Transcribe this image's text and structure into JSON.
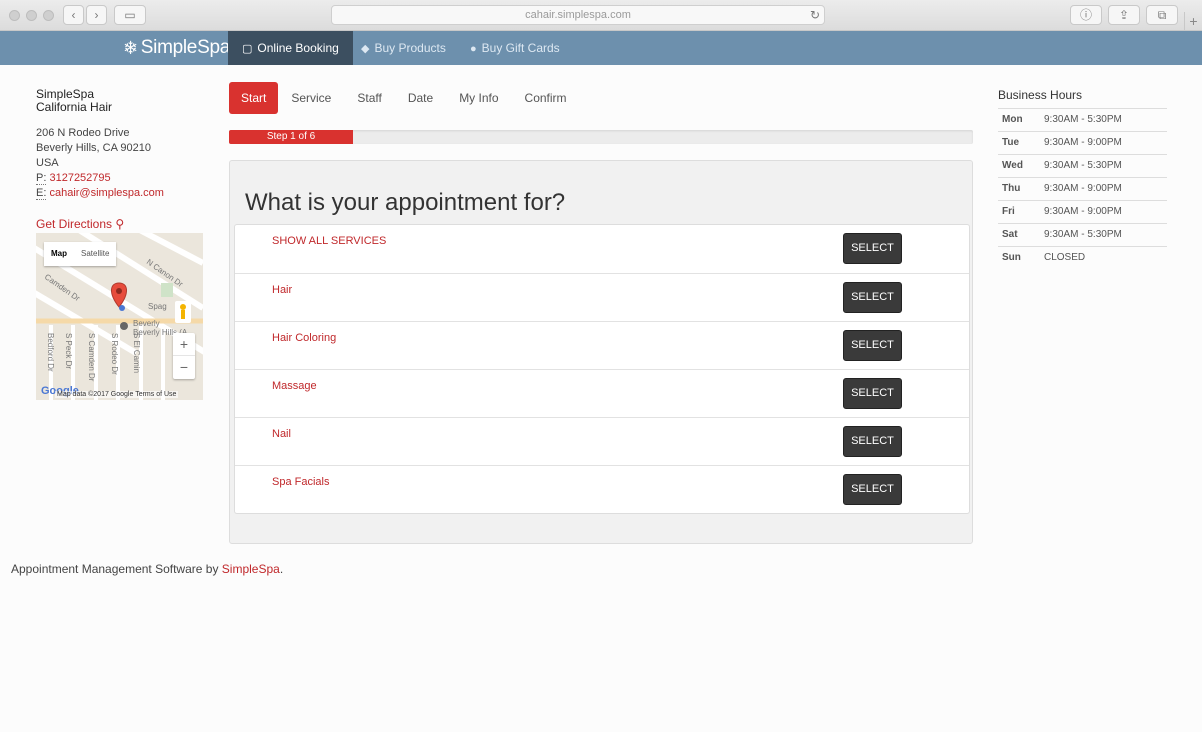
{
  "browser": {
    "url": "cahair.simplespa.com"
  },
  "nav": {
    "logo": "SimpleSpa",
    "items": [
      {
        "label": "Online Booking",
        "icon": "calendar-icon"
      },
      {
        "label": "Buy Products",
        "icon": "tag-icon"
      },
      {
        "label": "Buy Gift Cards",
        "icon": "circle-icon"
      }
    ]
  },
  "business": {
    "name": "SimpleSpa",
    "subname": "California Hair",
    "address1": "206 N Rodeo Drive",
    "address2": "Beverly Hills, CA 90210",
    "country": "USA",
    "phone_label": "P:",
    "phone": "3127252795",
    "email_label": "E:",
    "email": "cahair@simplespa.com",
    "directions": "Get Directions"
  },
  "map": {
    "toggle_map": "Map",
    "toggle_satellite": "Satellite",
    "footer": "Map data ©2017 Google  Terms of Use",
    "google": "Google"
  },
  "steps": [
    {
      "label": "Start",
      "active": true
    },
    {
      "label": "Service"
    },
    {
      "label": "Staff"
    },
    {
      "label": "Date"
    },
    {
      "label": "My Info"
    },
    {
      "label": "Confirm"
    }
  ],
  "progress": {
    "label": "Step 1 of 6",
    "fraction": 0.1667
  },
  "main": {
    "question": "What is your appointment for?",
    "select_label": "SELECT",
    "services": [
      "SHOW ALL SERVICES",
      "Hair",
      "Hair Coloring",
      "Massage",
      "Nail",
      "Spa Facials"
    ]
  },
  "hours": {
    "title": "Business Hours",
    "rows": [
      {
        "day": "Mon",
        "time": "9:30AM - 5:30PM"
      },
      {
        "day": "Tue",
        "time": "9:30AM - 9:00PM"
      },
      {
        "day": "Wed",
        "time": "9:30AM - 5:30PM"
      },
      {
        "day": "Thu",
        "time": "9:30AM - 9:00PM"
      },
      {
        "day": "Fri",
        "time": "9:30AM - 9:00PM"
      },
      {
        "day": "Sat",
        "time": "9:30AM - 5:30PM"
      },
      {
        "day": "Sun",
        "time": "CLOSED"
      }
    ]
  },
  "footer": {
    "text": "Appointment Management Software by ",
    "link": "SimpleSpa",
    "end": "."
  },
  "colors": {
    "accent": "#d9322f",
    "nav": "#6d90ad",
    "nav_active": "#3c4f60",
    "link": "#c0282b"
  }
}
